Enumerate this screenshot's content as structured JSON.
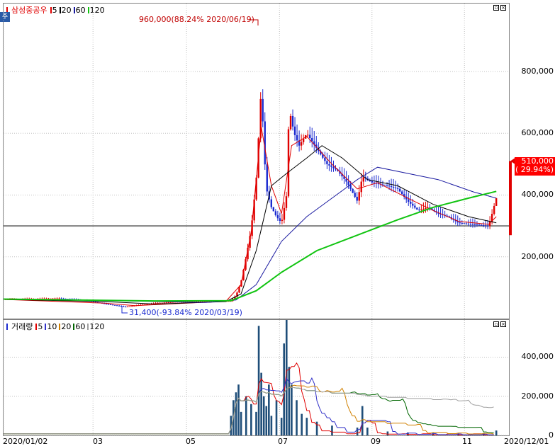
{
  "app": {
    "corner_icon": "주",
    "price_legend_name": "삼성중공우",
    "volume_legend_name": "거래량"
  },
  "price_legend": [
    {
      "label": "5",
      "color": "#e00000"
    },
    {
      "label": "20",
      "color": "#000000"
    },
    {
      "label": "60",
      "color": "#1a1aa0"
    },
    {
      "label": "120",
      "color": "#11c411"
    }
  ],
  "volume_legend": [
    {
      "label": "5",
      "color": "#e00000"
    },
    {
      "label": "10",
      "color": "#3232c8"
    },
    {
      "label": "20",
      "color": "#d08000"
    },
    {
      "label": "60",
      "color": "#006600"
    },
    {
      "label": "120",
      "color": "#a0a0a0"
    }
  ],
  "annotations": {
    "high": "960,000(88.24% 2020/06/19)",
    "low": "31,400(-93.84% 2020/03/19)",
    "last_price": "510,000",
    "last_change": "( 29.94%)"
  },
  "chart_data": [
    {
      "type": "candlestick",
      "pane": "price",
      "y_ticks": [
        {
          "label": "800,000",
          "value": 800000
        },
        {
          "label": "600,000",
          "value": 600000
        },
        {
          "label": "400,000",
          "value": 400000
        },
        {
          "label": "200,000",
          "value": 200000
        }
      ],
      "ylim": [
        0,
        1020000
      ],
      "reference_line": 300000,
      "x_labels": [
        "2020/01/02",
        "03",
        "05",
        "07",
        "09",
        "11",
        "2020/12/01"
      ],
      "colors": {
        "up": "#e00000",
        "down": "#1a2ad0",
        "ma5": "#e00000",
        "ma20": "#000000",
        "ma60": "#1a1aa0",
        "ma120": "#11c411",
        "ref": "#808080"
      },
      "segments": [
        {
          "t": 0,
          "v": 62000
        },
        {
          "t": 0.05,
          "v": 64000
        },
        {
          "t": 0.11,
          "v": 65000
        },
        {
          "t": 0.16,
          "v": 60000
        },
        {
          "t": 0.2,
          "v": 48000
        },
        {
          "t": 0.24,
          "v": 38000
        },
        {
          "t": 0.26,
          "v": 42000
        },
        {
          "t": 0.3,
          "v": 50000
        },
        {
          "t": 0.34,
          "v": 54000
        },
        {
          "t": 0.38,
          "v": 55000
        },
        {
          "t": 0.42,
          "v": 56000
        },
        {
          "t": 0.45,
          "v": 57000
        },
        {
          "t": 0.46,
          "v": 75000
        },
        {
          "t": 0.47,
          "v": 120000
        },
        {
          "t": 0.48,
          "v": 200000
        },
        {
          "t": 0.49,
          "v": 290000
        },
        {
          "t": 0.5,
          "v": 450000
        },
        {
          "t": 0.505,
          "v": 600000
        },
        {
          "t": 0.51,
          "v": 750000
        },
        {
          "t": 0.515,
          "v": 560000
        },
        {
          "t": 0.52,
          "v": 420000
        },
        {
          "t": 0.53,
          "v": 360000
        },
        {
          "t": 0.54,
          "v": 330000
        },
        {
          "t": 0.55,
          "v": 310000
        },
        {
          "t": 0.56,
          "v": 400000
        },
        {
          "t": 0.565,
          "v": 680000
        },
        {
          "t": 0.575,
          "v": 600000
        },
        {
          "t": 0.585,
          "v": 560000
        },
        {
          "t": 0.6,
          "v": 600000
        },
        {
          "t": 0.62,
          "v": 550000
        },
        {
          "t": 0.64,
          "v": 500000
        },
        {
          "t": 0.66,
          "v": 480000
        },
        {
          "t": 0.68,
          "v": 440000
        },
        {
          "t": 0.7,
          "v": 380000
        },
        {
          "t": 0.71,
          "v": 460000
        },
        {
          "t": 0.73,
          "v": 440000
        },
        {
          "t": 0.76,
          "v": 430000
        },
        {
          "t": 0.78,
          "v": 420000
        },
        {
          "t": 0.8,
          "v": 380000
        },
        {
          "t": 0.82,
          "v": 350000
        },
        {
          "t": 0.84,
          "v": 360000
        },
        {
          "t": 0.86,
          "v": 340000
        },
        {
          "t": 0.88,
          "v": 330000
        },
        {
          "t": 0.9,
          "v": 310000
        },
        {
          "t": 0.93,
          "v": 305000
        },
        {
          "t": 0.96,
          "v": 300000
        },
        {
          "t": 0.975,
          "v": 390000
        }
      ],
      "ma": {
        "ma5": [
          [
            0,
            62000
          ],
          [
            0.2,
            50000
          ],
          [
            0.26,
            42000
          ],
          [
            0.44,
            56000
          ],
          [
            0.47,
            110000
          ],
          [
            0.49,
            280000
          ],
          [
            0.51,
            620000
          ],
          [
            0.53,
            430000
          ],
          [
            0.55,
            340000
          ],
          [
            0.57,
            560000
          ],
          [
            0.6,
            590000
          ],
          [
            0.65,
            500000
          ],
          [
            0.7,
            420000
          ],
          [
            0.74,
            440000
          ],
          [
            0.8,
            390000
          ],
          [
            0.85,
            350000
          ],
          [
            0.9,
            315000
          ],
          [
            0.96,
            305000
          ],
          [
            0.975,
            330000
          ]
        ],
        "ma20": [
          [
            0,
            62000
          ],
          [
            0.2,
            55000
          ],
          [
            0.3,
            47000
          ],
          [
            0.44,
            55000
          ],
          [
            0.47,
            80000
          ],
          [
            0.5,
            220000
          ],
          [
            0.53,
            430000
          ],
          [
            0.56,
            470000
          ],
          [
            0.6,
            520000
          ],
          [
            0.63,
            560000
          ],
          [
            0.67,
            520000
          ],
          [
            0.72,
            450000
          ],
          [
            0.78,
            430000
          ],
          [
            0.85,
            370000
          ],
          [
            0.92,
            330000
          ],
          [
            0.975,
            310000
          ]
        ],
        "ma60": [
          [
            0,
            63000
          ],
          [
            0.22,
            58000
          ],
          [
            0.4,
            52000
          ],
          [
            0.46,
            60000
          ],
          [
            0.5,
            110000
          ],
          [
            0.55,
            250000
          ],
          [
            0.6,
            330000
          ],
          [
            0.65,
            390000
          ],
          [
            0.7,
            450000
          ],
          [
            0.74,
            490000
          ],
          [
            0.8,
            470000
          ],
          [
            0.86,
            450000
          ],
          [
            0.93,
            410000
          ],
          [
            0.975,
            390000
          ]
        ],
        "ma120": [
          [
            0,
            63000
          ],
          [
            0.3,
            57000
          ],
          [
            0.45,
            58000
          ],
          [
            0.5,
            90000
          ],
          [
            0.55,
            150000
          ],
          [
            0.62,
            220000
          ],
          [
            0.7,
            270000
          ],
          [
            0.78,
            320000
          ],
          [
            0.85,
            360000
          ],
          [
            0.92,
            390000
          ],
          [
            0.975,
            412000
          ]
        ]
      }
    },
    {
      "type": "bar",
      "pane": "volume",
      "y_ticks": [
        {
          "label": "400,000",
          "value": 400000
        },
        {
          "label": "200,000",
          "value": 200000
        },
        {
          "label": "0",
          "value": 0
        }
      ],
      "ylim": [
        0,
        590000
      ],
      "bars": [
        [
          0.45,
          100000
        ],
        [
          0.455,
          180000
        ],
        [
          0.46,
          220000
        ],
        [
          0.465,
          260000
        ],
        [
          0.47,
          120000
        ],
        [
          0.48,
          200000
        ],
        [
          0.49,
          160000
        ],
        [
          0.5,
          120000
        ],
        [
          0.505,
          560000
        ],
        [
          0.51,
          320000
        ],
        [
          0.515,
          200000
        ],
        [
          0.52,
          150000
        ],
        [
          0.525,
          260000
        ],
        [
          0.53,
          100000
        ],
        [
          0.54,
          180000
        ],
        [
          0.55,
          90000
        ],
        [
          0.555,
          470000
        ],
        [
          0.56,
          590000
        ],
        [
          0.565,
          350000
        ],
        [
          0.57,
          260000
        ],
        [
          0.58,
          180000
        ],
        [
          0.59,
          110000
        ],
        [
          0.6,
          90000
        ],
        [
          0.62,
          70000
        ],
        [
          0.65,
          50000
        ],
        [
          0.7,
          40000
        ],
        [
          0.71,
          150000
        ],
        [
          0.72,
          40000
        ],
        [
          0.76,
          20000
        ],
        [
          0.8,
          15000
        ],
        [
          0.85,
          12000
        ],
        [
          0.9,
          10000
        ],
        [
          0.95,
          10000
        ],
        [
          0.975,
          25000
        ]
      ]
    }
  ]
}
